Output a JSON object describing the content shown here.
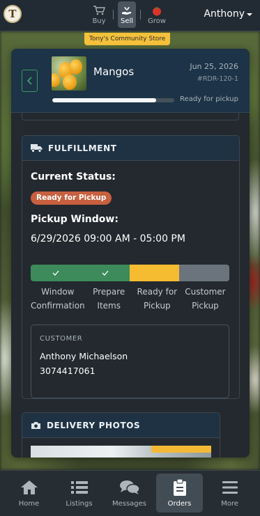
{
  "header": {
    "modes": [
      {
        "label": "Buy",
        "icon": "shopping-cart-icon",
        "active": false
      },
      {
        "label": "Sell",
        "icon": "hand-holding-sprout-icon",
        "active": true
      },
      {
        "label": "Grow",
        "icon": "tomato-icon",
        "active": false
      }
    ],
    "user_name": "Anthony",
    "store_name": "Tony's Community Store"
  },
  "order": {
    "product_name": "Mangos",
    "date": "Jun 25, 2026",
    "order_id": "#RDR-120-1",
    "progress_fraction": 0.85,
    "progress_label": "Ready for pickup"
  },
  "fulfillment": {
    "section_title": "FULFILLMENT",
    "current_status_label": "Current Status:",
    "status_badge": "Ready for Pickup",
    "pickup_window_label": "Pickup Window:",
    "pickup_window_value": "6/29/2026 09:00 AM - 05:00 PM",
    "steps": [
      {
        "label_line1": "Window",
        "label_line2": "Confirmation",
        "state": "done"
      },
      {
        "label_line1": "Prepare",
        "label_line2": "Items",
        "state": "done"
      },
      {
        "label_line1": "Ready for",
        "label_line2": "Pickup",
        "state": "current"
      },
      {
        "label_line1": "Customer",
        "label_line2": "Pickup",
        "state": "pending"
      }
    ],
    "step_colors": {
      "done": "#3d8a5a",
      "current": "#f5bc32",
      "pending": "#6b747c"
    },
    "customer": {
      "label": "CUSTOMER",
      "name": "Anthony Michaelson",
      "phone": "3074417061"
    }
  },
  "delivery_photos": {
    "section_title": "DELIVERY PHOTOS"
  },
  "bottom_nav": [
    {
      "label": "Home",
      "icon": "home-icon",
      "active": false
    },
    {
      "label": "Listings",
      "icon": "list-icon",
      "active": false
    },
    {
      "label": "Messages",
      "icon": "chat-bubbles-icon",
      "active": false
    },
    {
      "label": "Orders",
      "icon": "clipboard-icon",
      "active": true
    },
    {
      "label": "More",
      "icon": "menu-icon",
      "active": false
    }
  ]
}
